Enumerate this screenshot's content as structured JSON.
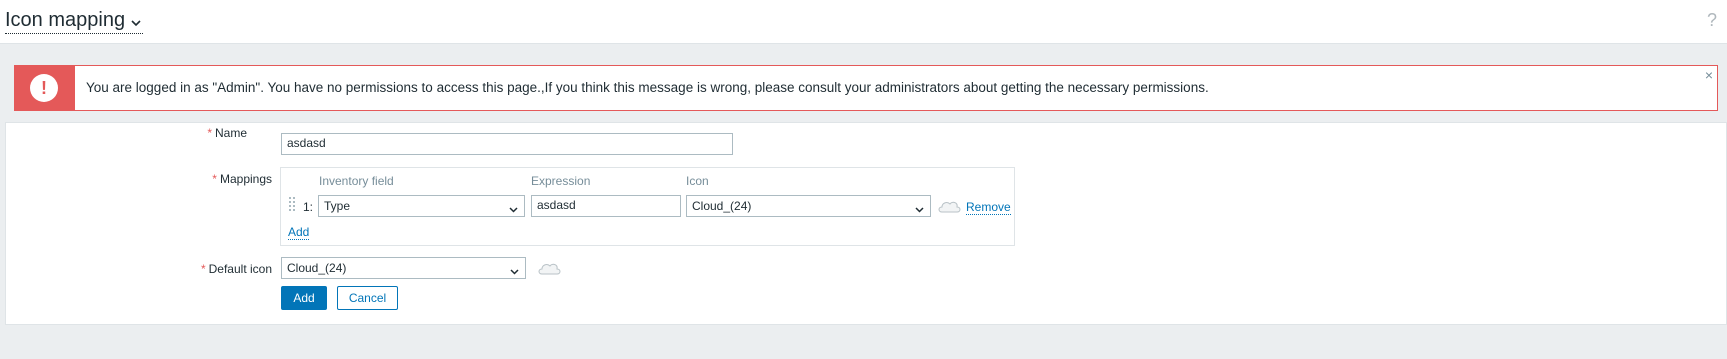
{
  "header": {
    "title": "Icon mapping",
    "help_icon": "?"
  },
  "alert": {
    "icon": "exclamation-icon",
    "symbol": "!",
    "message": "You are logged in as \"Admin\". You have no permissions to access this page.,If you think this message is wrong, please consult your administrators about getting the necessary permissions.",
    "close": "×",
    "color": "#e45959"
  },
  "form": {
    "name_label": "Name",
    "name_value": "asdasd",
    "mappings_label": "Mappings",
    "columns": {
      "inventory_field": "Inventory field",
      "expression": "Expression",
      "icon": "Icon"
    },
    "rows": [
      {
        "index": "1:",
        "inventory_field": "Type",
        "expression": "asdasd",
        "icon": "Cloud_(24)",
        "remove_label": "Remove"
      }
    ],
    "add_mapping_label": "Add",
    "default_icon_label": "Default icon",
    "default_icon_value": "Cloud_(24)",
    "required_marker": "*"
  },
  "buttons": {
    "add": "Add",
    "cancel": "Cancel"
  },
  "colors": {
    "accent": "#0275b8",
    "error": "#e45959",
    "background": "#ebeef0"
  }
}
